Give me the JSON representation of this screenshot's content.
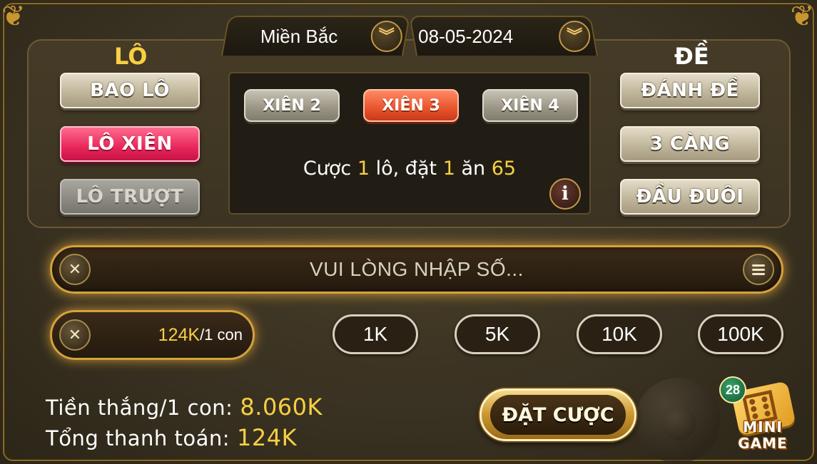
{
  "header": {
    "region": "Miền Bắc",
    "date": "08-05-2024"
  },
  "lo": {
    "title": "LÔ",
    "buttons": [
      "BAO LÔ",
      "LÔ XIÊN",
      "LÔ TRƯỢT"
    ],
    "selected": "LÔ XIÊN",
    "disabled": "LÔ TRƯỢT"
  },
  "de": {
    "title": "ĐỀ",
    "buttons": [
      "ĐÁNH ĐỀ",
      "3 CÀNG",
      "ĐẦU ĐUÔI"
    ]
  },
  "xien": {
    "options": [
      "XIÊN 2",
      "XIÊN 3",
      "XIÊN 4"
    ],
    "selected": "XIÊN 3"
  },
  "bet_info": {
    "prefix": "Cược",
    "lo_count": "1",
    "middle": "lô, đặt",
    "stake": "1",
    "win_word": "ăn",
    "payout": "65"
  },
  "number_input": {
    "placeholder": "VUI LÒNG NHẬP SỐ..."
  },
  "amount": {
    "value": "124K",
    "unit": "/1 con"
  },
  "chips": [
    "1K",
    "5K",
    "10K",
    "100K"
  ],
  "totals": {
    "win_label": "Tiền thắng/1 con:",
    "win_value": "8.060K",
    "pay_label": "Tổng thanh toán:",
    "pay_value": "124K"
  },
  "bet_button": "ĐẶT CƯỢC",
  "mini_game": {
    "badge": "28",
    "line1": "MINI",
    "line2": "GAME"
  },
  "colors": {
    "accent_gold": "#f7d043",
    "selected_pink": "#e8275a",
    "selected_orange": "#e8542c"
  }
}
